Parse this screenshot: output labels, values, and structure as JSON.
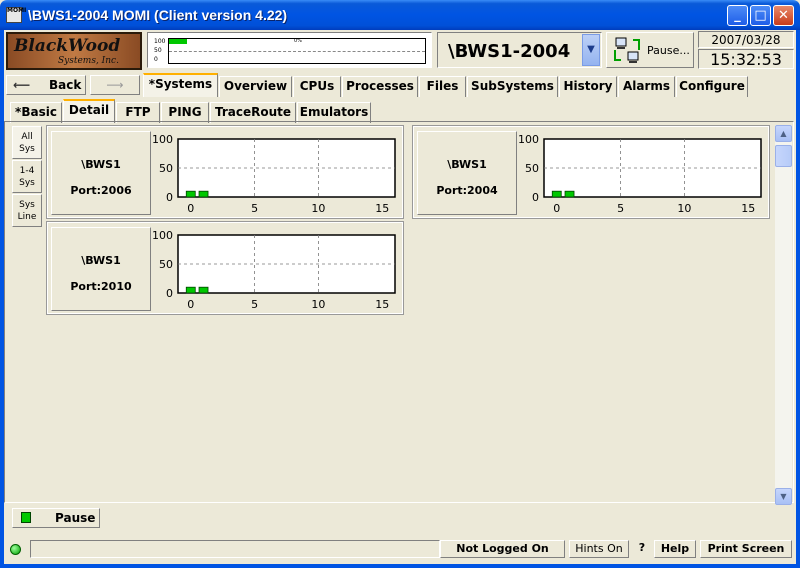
{
  "window": {
    "title": "\\BWS1-2004 MOMI (Client version 4.22)",
    "app_icon_text": "MOMI",
    "minimize": "_",
    "maximize": "□",
    "close": "✕"
  },
  "header": {
    "logo_line1": "BlackWood",
    "logo_line2": "Systems, Inc.",
    "mini_graph": {
      "scale": [
        "100",
        "50",
        "0"
      ],
      "value_percent_label": "0%",
      "value_fraction": 0.07
    },
    "system_name": "\\BWS1-2004",
    "pause_label": "Pause...",
    "date": "2007/03/28",
    "time": "15:32:53"
  },
  "nav": {
    "back_label": "Back",
    "main_tabs": [
      "*Systems",
      "Overview",
      "CPUs",
      "Processes",
      "Files",
      "SubSystems",
      "History",
      "Alarms",
      "Configure"
    ],
    "sub_tabs": [
      "*Basic",
      "Detail",
      "FTP",
      "PING",
      "TraceRoute",
      "Emulators"
    ]
  },
  "side_buttons": [
    {
      "line1": "All",
      "line2": "Sys"
    },
    {
      "line1": "1-4",
      "line2": "Sys"
    },
    {
      "line1": "Sys",
      "line2": "Line"
    }
  ],
  "panels": [
    {
      "name": "\\BWS1",
      "port": "Port:2006"
    },
    {
      "name": "\\BWS1",
      "port": "Port:2004"
    },
    {
      "name": "\\BWS1",
      "port": "Port:2010"
    }
  ],
  "chart_data": [
    {
      "type": "bar",
      "x": [
        0,
        1
      ],
      "values": [
        10,
        10
      ],
      "xlim": [
        -1,
        16
      ],
      "ylim": [
        0,
        100
      ],
      "xticks": [
        "0",
        "5",
        "10",
        "15"
      ],
      "yticks": [
        "100",
        "50",
        "0"
      ],
      "grid": true
    },
    {
      "type": "bar",
      "x": [
        0,
        1
      ],
      "values": [
        10,
        10
      ],
      "xlim": [
        -1,
        16
      ],
      "ylim": [
        0,
        100
      ],
      "xticks": [
        "0",
        "5",
        "10",
        "15"
      ],
      "yticks": [
        "100",
        "50",
        "0"
      ],
      "grid": true
    },
    {
      "type": "bar",
      "x": [
        0,
        1
      ],
      "values": [
        10,
        10
      ],
      "xlim": [
        -1,
        16
      ],
      "ylim": [
        0,
        100
      ],
      "xticks": [
        "0",
        "5",
        "10",
        "15"
      ],
      "yticks": [
        "100",
        "50",
        "0"
      ],
      "grid": true
    }
  ],
  "footer": {
    "pause_label": "Pause",
    "not_logged_on": "Not Logged On",
    "hints_on": "Hints On",
    "question": "?",
    "help": "Help",
    "print_screen": "Print Screen"
  },
  "colors": {
    "bar": "#00c800",
    "titlebar": "#0054e3",
    "active_tab_accent": "#ffb000"
  }
}
